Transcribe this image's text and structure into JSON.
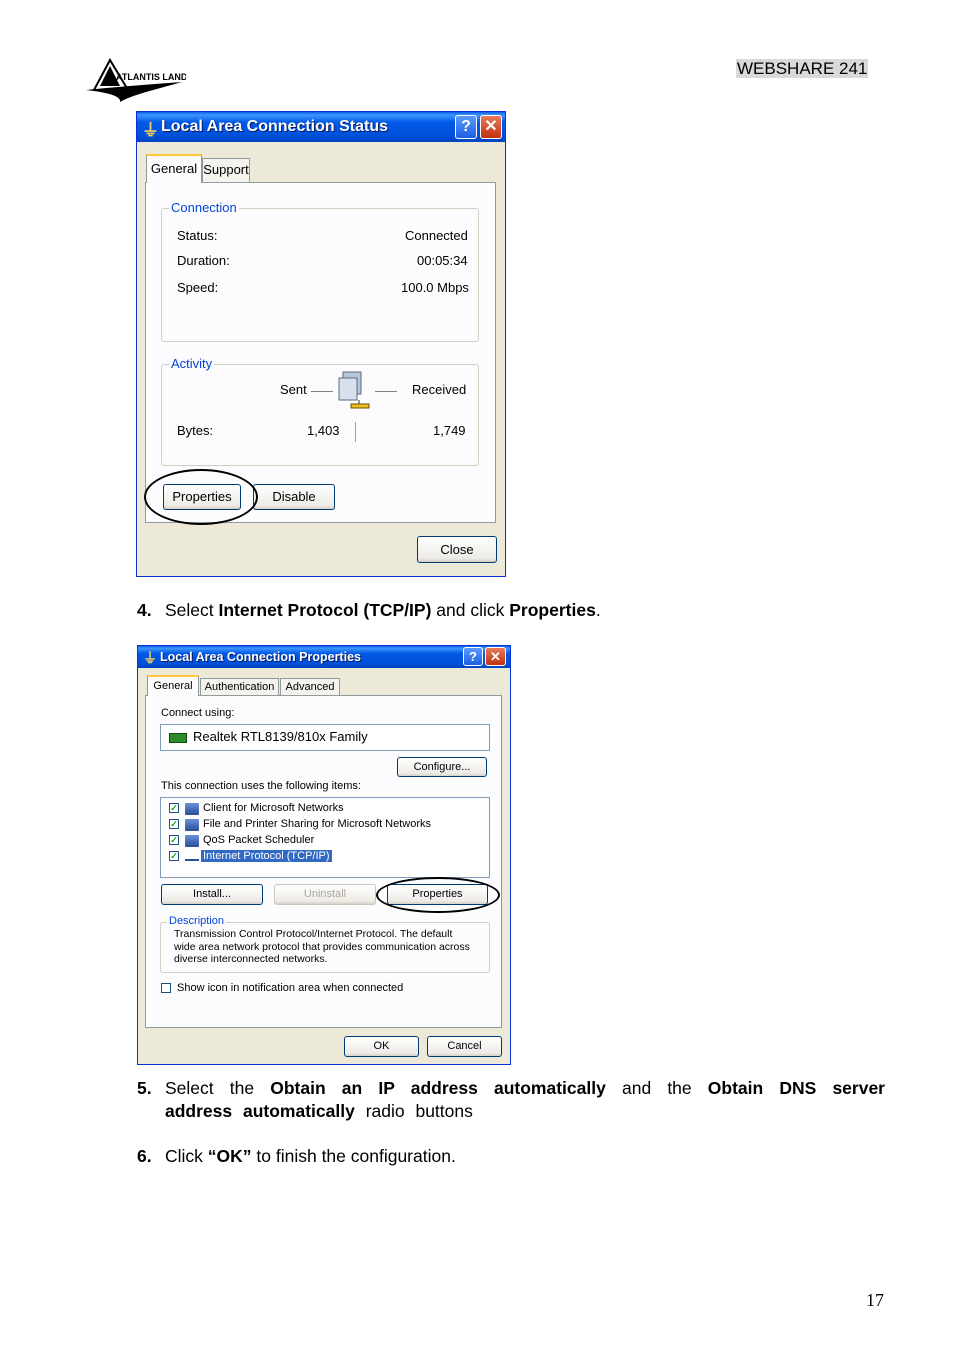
{
  "header": {
    "product": "WEBSHARE 241",
    "logo_text": "ATLANTIS LAND"
  },
  "status_dialog": {
    "title": "Local Area Connection Status",
    "tabs": [
      "General",
      "Support"
    ],
    "connection_group": "Connection",
    "rows": [
      {
        "label": "Status:",
        "value": "Connected"
      },
      {
        "label": "Duration:",
        "value": "00:05:34"
      },
      {
        "label": "Speed:",
        "value": "100.0 Mbps"
      }
    ],
    "activity_group": "Activity",
    "sent_label": "Sent",
    "received_label": "Received",
    "bytes_label": "Bytes:",
    "bytes_sent": "1,403",
    "bytes_received": "1,749",
    "properties_button": "Properties",
    "disable_button": "Disable",
    "close_button": "Close"
  },
  "step4": {
    "number": "4.",
    "pre": "Select ",
    "bold1": "Internet Protocol (TCP/IP)",
    "mid": " and click ",
    "bold2": "Properties",
    "post": "."
  },
  "properties_dialog": {
    "title": "Local Area Connection Properties",
    "tabs": [
      "General",
      "Authentication",
      "Advanced"
    ],
    "connect_using_label": "Connect using:",
    "adapter": "Realtek RTL8139/810x Family",
    "configure_button": "Configure...",
    "items_label": "This connection uses the following items:",
    "items": [
      {
        "label": "Client for Microsoft Networks",
        "checked": true
      },
      {
        "label": "File and Printer Sharing for Microsoft Networks",
        "checked": true
      },
      {
        "label": "QoS Packet Scheduler",
        "checked": true
      },
      {
        "label": "Internet Protocol (TCP/IP)",
        "checked": true,
        "selected": true
      }
    ],
    "install_button": "Install...",
    "uninstall_button": "Uninstall",
    "properties_button": "Properties",
    "description_group": "Description",
    "description_text": "Transmission Control Protocol/Internet Protocol. The default wide area network protocol that provides communication across diverse interconnected networks.",
    "show_icon_label": "Show icon in notification area when connected",
    "ok_button": "OK",
    "cancel_button": "Cancel"
  },
  "step5": {
    "number": "5.",
    "pre": "Select the ",
    "bold1": "Obtain an IP address automatically",
    "mid": " and the ",
    "bold2": "Obtain DNS server address automatically",
    "post": " radio buttons"
  },
  "step6": {
    "number": "6.",
    "pre": "Click ",
    "bold1": "“OK”",
    "post": " to finish the configuration."
  },
  "page_number": "17"
}
